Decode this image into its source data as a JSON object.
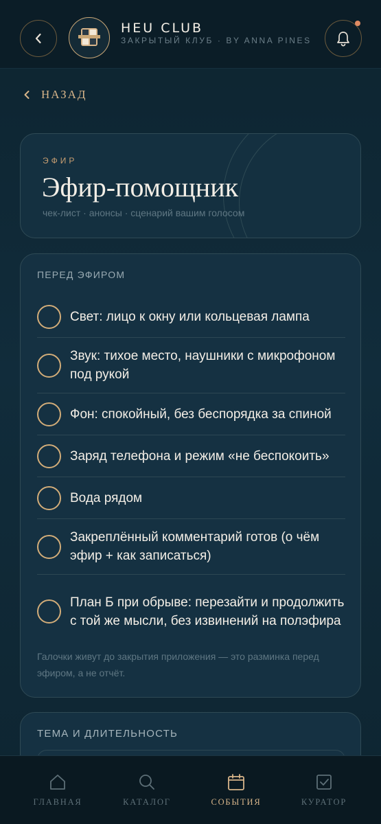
{
  "header": {
    "title": "HEU CLUB",
    "subtitle": "ЗАКРЫТЫЙ КЛУБ · BY ANNA PINES",
    "logo_icon": "crest-logo",
    "notification_dot_color": "#e08b63"
  },
  "back_link": {
    "label": "НАЗАД"
  },
  "hero": {
    "kicker": "ЭФИР",
    "title": "Эфир-помощник",
    "subtitle": "чек-лист · анонсы · сценарий вашим голосом"
  },
  "checklist": {
    "section_title": "ПЕРЕД ЭФИРОМ",
    "items": [
      {
        "label": "Свет: лицо к окну или кольцевая лампа",
        "checked": false
      },
      {
        "label": "Звук: тихое место, наушники с микрофоном под рукой",
        "checked": false
      },
      {
        "label": "Фон: спокойный, без беспорядка за спиной",
        "checked": false
      },
      {
        "label": "Заряд телефона и режим «не беспокоить»",
        "checked": false
      },
      {
        "label": "Вода рядом",
        "checked": false
      },
      {
        "label": "Закреплённый комментарий готов (о чём эфир + как записаться)",
        "checked": false
      },
      {
        "label": "План Б при обрыве: перезайти и продолжить с той же мысли, без извинений на полэфира",
        "checked": false
      }
    ],
    "note": "Галочки живут до закрытия приложения — это разминка перед эфиром, а не отчёт."
  },
  "topic_section": {
    "section_title": "ТЕМА И ДЛИТЕЛЬНОСТЬ"
  },
  "bottom_nav": {
    "items": [
      {
        "label": "ГЛАВНАЯ",
        "icon": "home-icon",
        "active": false
      },
      {
        "label": "КАТАЛОГ",
        "icon": "search-icon",
        "active": false
      },
      {
        "label": "СОБЫТИЯ",
        "icon": "calendar-icon",
        "active": true
      },
      {
        "label": "КУРАТОР",
        "icon": "checkbox-icon",
        "active": false
      }
    ]
  },
  "colors": {
    "accent": "#d8b58a",
    "background": "#112c3b",
    "card": "#153142"
  }
}
